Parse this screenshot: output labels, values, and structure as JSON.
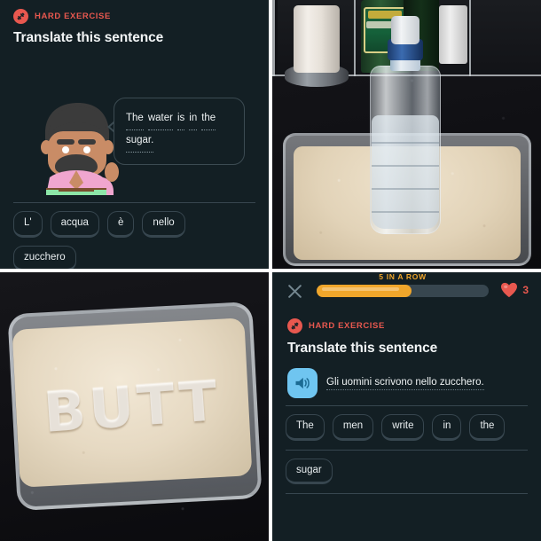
{
  "exercise_left": {
    "badge": {
      "icon": "dumbbell-icon",
      "label": "HARD EXERCISE",
      "color": "#e8584f"
    },
    "title": "Translate this sentence",
    "character": {
      "name": "duolingo-character-oscar",
      "shirt_color": "#f0a6cf",
      "pants_color": "#8de6a8",
      "hair_color": "#3b3b3b",
      "skin_color": "#c98c66"
    },
    "bubble": {
      "line1_words": [
        "The",
        "water",
        "is",
        "in",
        "the"
      ],
      "line2_words": [
        "sugar."
      ],
      "full_text": "The water is in the sugar."
    },
    "word_bank": [
      "L'",
      "acqua",
      "è",
      "nello",
      "zucchero"
    ]
  },
  "exercise_right": {
    "topbar": {
      "close_icon": "close-x-icon",
      "streak_label": "5 IN A ROW",
      "progress_percent": 55,
      "progress_color": "#f0a62b",
      "heart_icon": "heart-icon",
      "hearts_count": "3",
      "hearts_color": "#e8584f"
    },
    "badge": {
      "icon": "dumbbell-icon",
      "label": "HARD EXERCISE",
      "color": "#e8584f"
    },
    "title": "Translate this sentence",
    "speaker_icon": "speaker-icon",
    "sentence": "Gli uomini scrivono nello zucchero.",
    "word_bank_row1": [
      "The",
      "men",
      "write",
      "in",
      "the"
    ],
    "word_bank_row2": [
      "sugar"
    ]
  },
  "photo_top_right": {
    "name": "water-bottle-in-sugar-tub-photo",
    "description": "Plastic water bottle standing upright in a tub of sugar on a dark granite kitchen counter"
  },
  "photo_bottom_left": {
    "name": "sugar-tub-word-photo",
    "description": "Tub of sugar with a word drawn in it",
    "written_word": "BUTT"
  }
}
